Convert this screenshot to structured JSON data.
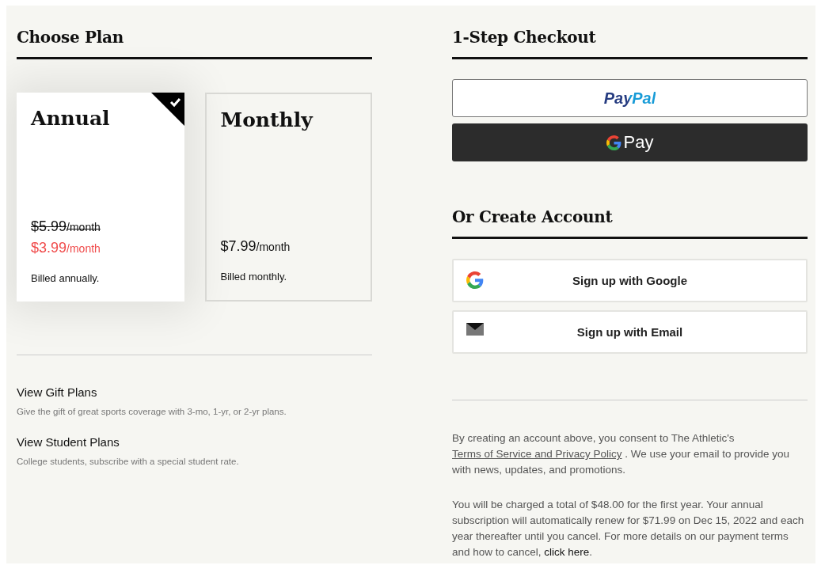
{
  "choose_plan": {
    "title": "Choose Plan",
    "plans": [
      {
        "name": "Annual",
        "selected": true,
        "original_price": {
          "amount": "$5.99",
          "unit": "/month"
        },
        "price": {
          "amount": "$3.99",
          "unit": "/month"
        },
        "billing": "Billed annually."
      },
      {
        "name": "Monthly",
        "selected": false,
        "price": {
          "amount": "$7.99",
          "unit": "/month"
        },
        "billing": "Billed monthly."
      }
    ],
    "links": [
      {
        "title": "View Gift Plans",
        "description": "Give the gift of great sports coverage with 3-mo, 1-yr, or 2-yr plans."
      },
      {
        "title": "View Student Plans",
        "description": "College students, subscribe with a special student rate."
      }
    ]
  },
  "checkout": {
    "title": "1-Step Checkout",
    "buttons": [
      {
        "kind": "paypal",
        "label": "PayPal"
      },
      {
        "kind": "gpay",
        "label": "Pay"
      }
    ]
  },
  "create_account": {
    "title": "Or Create Account",
    "buttons": [
      {
        "kind": "google",
        "label": "Sign up with Google"
      },
      {
        "kind": "email",
        "label": "Sign up with Email"
      }
    ]
  },
  "consent": {
    "before": "By creating an account above, you consent to The Athletic's ",
    "link": "Terms of Service and Privacy Policy",
    "after": " . We use your email to provide you with news, updates, and promotions."
  },
  "charges": {
    "before": "You will be charged a total of $48.00 for the first year. Your annual subscription will automatically renew for $71.99 on Dec 15, 2022 and each year thereafter until you cancel. For more details on our payment terms and how to cancel, ",
    "link": "click here",
    "after": "."
  }
}
